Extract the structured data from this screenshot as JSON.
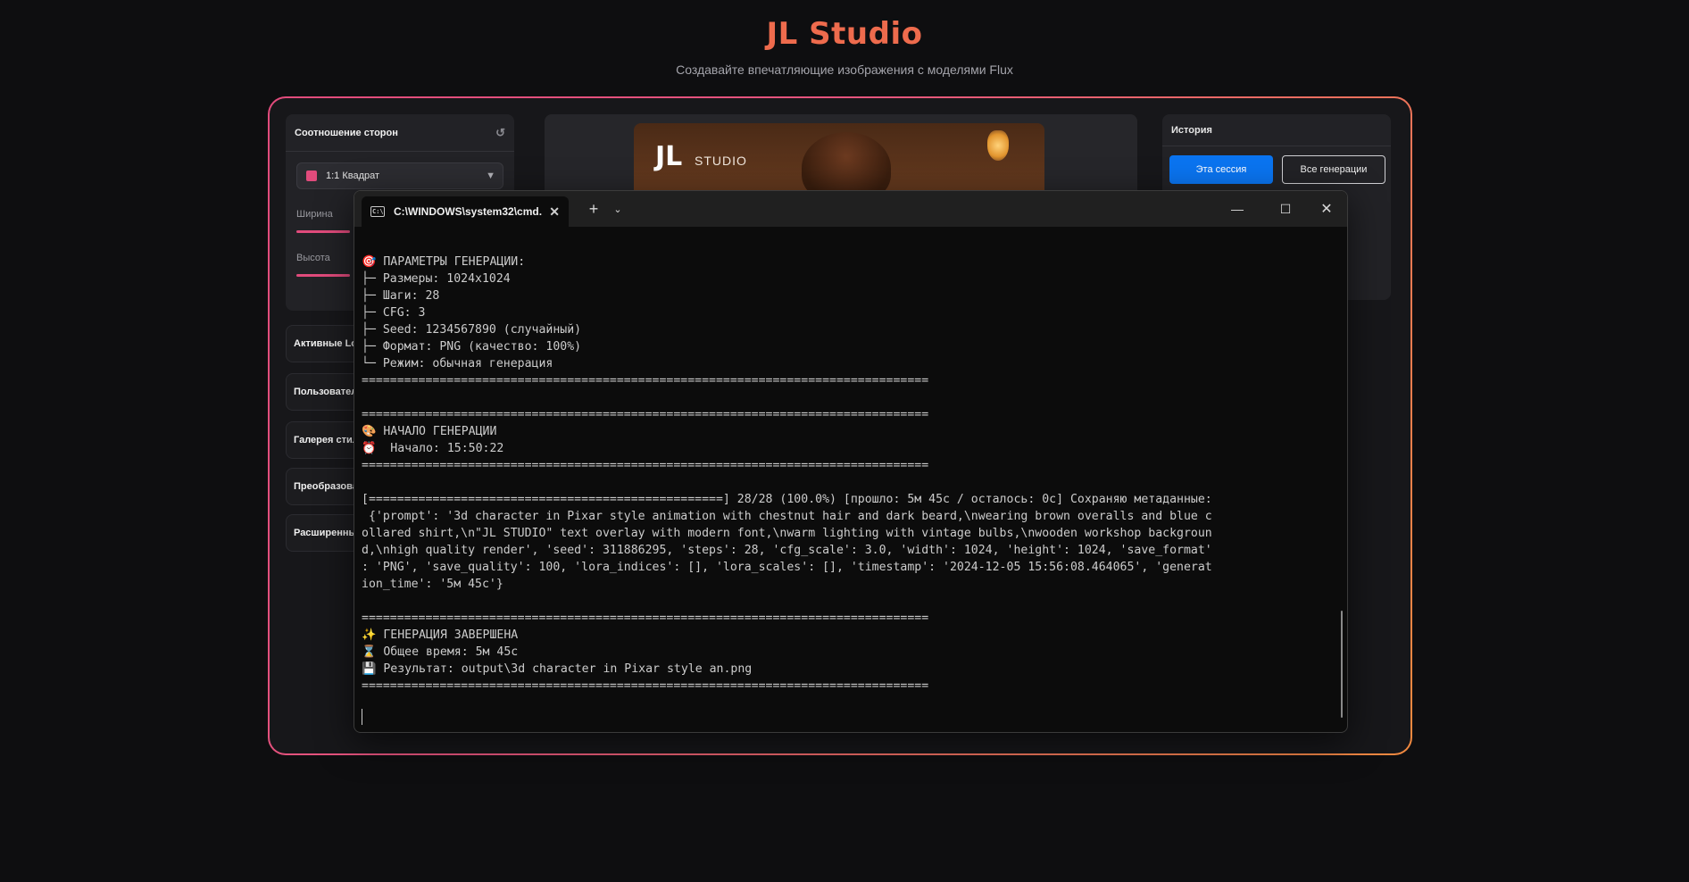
{
  "header": {
    "title": "JL Studio",
    "subtitle": "Создавайте впечатляющие изображения с моделями Flux"
  },
  "left_panel": {
    "section_title": "Соотношение сторон",
    "aspect_value": "1:1 Квадрат",
    "width_label": "Ширина",
    "height_label": "Высота",
    "accordions": [
      "Активные Lo",
      "Пользовател",
      "Галерея стил",
      "Преобразова",
      "Расширенны"
    ]
  },
  "preview": {
    "logo_big": "JL",
    "logo_small": "STUDIO"
  },
  "history": {
    "title": "История",
    "btn_session": "Эта сессия",
    "btn_all": "Все генерации"
  },
  "terminal": {
    "tab_title": "C:\\WINDOWS\\system32\\cmd.",
    "lines": [
      "🎯 ПАРАМЕТРЫ ГЕНЕРАЦИИ:",
      "├─ Размеры: 1024x1024",
      "├─ Шаги: 28",
      "├─ CFG: 3",
      "├─ Seed: 1234567890 (случайный)",
      "├─ Формат: PNG (качество: 100%)",
      "└─ Режим: обычная генерация",
      "================================================================================",
      "",
      "================================================================================",
      "🎨 НАЧАЛО ГЕНЕРАЦИИ",
      "⏰  Начало: 15:50:22",
      "================================================================================",
      "",
      "[==================================================] 28/28 (100.0%) [прошло: 5м 45с / осталось: 0с] Сохраняю метаданные:",
      " {'prompt': '3d character in Pixar style animation with chestnut hair and dark beard,\\nwearing brown overalls and blue c",
      "ollared shirt,\\n\"JL STUDIO\" text overlay with modern font,\\nwarm lighting with vintage bulbs,\\nwooden workshop backgroun",
      "d,\\nhigh quality render', 'seed': 311886295, 'steps': 28, 'cfg_scale': 3.0, 'width': 1024, 'height': 1024, 'save_format'",
      ": 'PNG', 'save_quality': 100, 'lora_indices': [], 'lora_scales': [], 'timestamp': '2024-12-05 15:56:08.464065', 'generat",
      "ion_time': '5м 45с'}",
      "",
      "================================================================================",
      "✨ ГЕНЕРАЦИЯ ЗАВЕРШЕНА",
      "⌛ Общее время: 5м 45с",
      "💾 Результат: output\\3d character in Pixar style an.png",
      "================================================================================"
    ]
  },
  "colors": {
    "accent_pink": "#e14b7c",
    "accent_orange": "#f0893f",
    "title_color": "#ee6b4d",
    "button_blue": "#0a74f0"
  },
  "icons": [
    "reset-icon",
    "chevron-down-icon",
    "cmd-icon",
    "close-icon",
    "plus-icon",
    "minimize-icon",
    "maximize-icon"
  ]
}
